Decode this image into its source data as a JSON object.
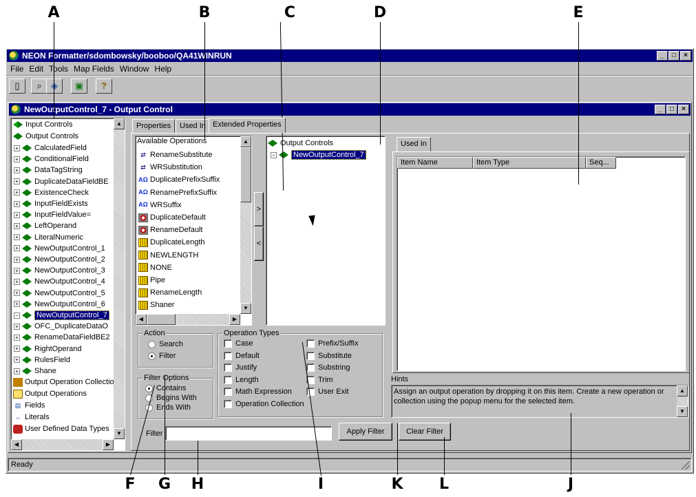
{
  "callouts": [
    "A",
    "B",
    "C",
    "D",
    "E",
    "F",
    "G",
    "H",
    "I",
    "K",
    "L",
    "J"
  ],
  "app": {
    "title": "NEON Formatter/sdombowsky/booboo/QA41WINRUN",
    "menu": [
      "File",
      "Edit",
      "Tools",
      "Map Fields",
      "Window",
      "Help"
    ],
    "toolbar_icons": [
      "new-document-icon",
      "find-icon",
      "map-icon",
      "network-icon",
      "help-icon"
    ],
    "status": "Ready"
  },
  "child_window": {
    "title": "NewOutputControl_7 - Output Control"
  },
  "tree": {
    "roots": [
      "Input Controls",
      "Output Controls"
    ],
    "output_controls": [
      "CalculatedField",
      "ConditionalField",
      "DataTagString",
      "DuplicateDataFieldBE",
      "ExistenceCheck",
      "InputFieldExists",
      "InputFieldValue=",
      "LeftOperand",
      "LiteralNumeric",
      "NewOutputControl_1",
      "NewOutputControl_2",
      "NewOutputControl_3",
      "NewOutputControl_4",
      "NewOutputControl_5",
      "NewOutputControl_6",
      "NewOutputControl_7",
      "OFC_DuplicateDataO",
      "RenameDataFieldBE2",
      "RightOperand",
      "RulesField",
      "Shane"
    ],
    "selected": "NewOutputControl_7",
    "bottom_items": [
      "Output Operation Collectio",
      "Output Operations",
      "Fields",
      "Literals",
      "User Defined Data Types"
    ]
  },
  "tabs": [
    "Properties",
    "Used In",
    "Extended Properties"
  ],
  "active_tab": "Extended Properties",
  "available_operations": {
    "header": "Available Operations",
    "items": [
      {
        "label": "RenameSubstitute",
        "icon": "substitute-icon"
      },
      {
        "label": "WRSubstitution",
        "icon": "substitute-icon"
      },
      {
        "label": "DuplicatePrefixSuffix",
        "icon": "prefix-suffix-icon"
      },
      {
        "label": "RenamePrefixSuffix",
        "icon": "prefix-suffix-icon"
      },
      {
        "label": "WRSuffix",
        "icon": "prefix-suffix-icon"
      },
      {
        "label": "DuplicateDefault",
        "icon": "default-icon"
      },
      {
        "label": "RenameDefault",
        "icon": "default-icon"
      },
      {
        "label": "DuplicateLength",
        "icon": "length-icon"
      },
      {
        "label": "NEWLENGTH",
        "icon": "length-icon"
      },
      {
        "label": "NONE",
        "icon": "length-icon"
      },
      {
        "label": "Pipe",
        "icon": "length-icon"
      },
      {
        "label": "RenameLength",
        "icon": "length-icon"
      },
      {
        "label": "Shaner",
        "icon": "length-icon"
      }
    ]
  },
  "move_buttons": {
    "add": ">",
    "remove": "<"
  },
  "assigned": {
    "root": "Output Controls",
    "child": "NewOutputControl_7"
  },
  "used_in": {
    "tab": "Used In",
    "columns": [
      "Item Name",
      "Item Type",
      "Seq..."
    ]
  },
  "action": {
    "label": "Action",
    "options": [
      "Search",
      "Filter"
    ],
    "selected": "Filter"
  },
  "filter_options": {
    "label": "Filter Options",
    "options": [
      "Contains",
      "Begins With",
      "Ends With"
    ],
    "selected": "Contains"
  },
  "operation_types": {
    "label": "Operation Types",
    "col1": [
      "Case",
      "Default",
      "Justify",
      "Length",
      "Math Expression",
      "Operation Collection"
    ],
    "col2": [
      "Prefix/Suffix",
      "Substitute",
      "Substring",
      "Trim",
      "User Exit"
    ]
  },
  "filter": {
    "label": "Filter",
    "value": "",
    "apply": "Apply Filter",
    "clear": "Clear Filter"
  },
  "hints": {
    "label": "Hints",
    "text": "Assign an output operation by dropping it on this item. Create a  new operation or collection using the popup menu for the selected item."
  }
}
